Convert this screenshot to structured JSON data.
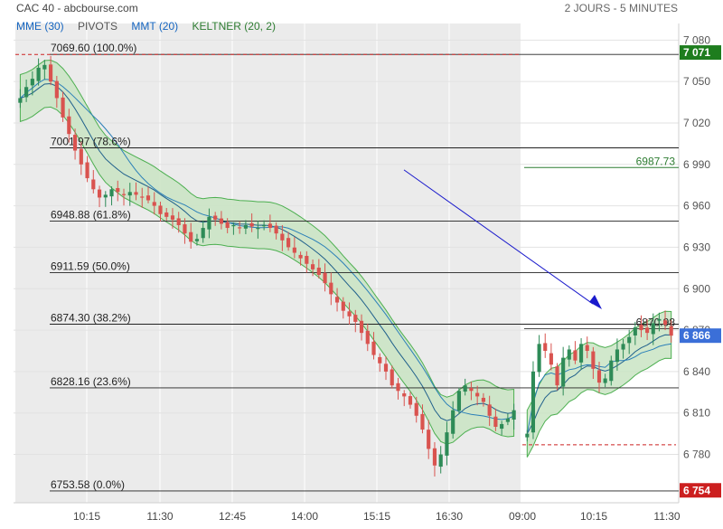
{
  "header": {
    "source": "CAC 40 - abcbourse.com",
    "timeframe": "2 JOURS - 5 MINUTES"
  },
  "legend": [
    {
      "label": "MME (30)",
      "color": "#1565c0"
    },
    {
      "label": "PIVOTS",
      "color": "#555555"
    },
    {
      "label": "MMT (20)",
      "color": "#1565c0"
    },
    {
      "label": "KELTNER (20, 2)",
      "color": "#2e7d32"
    }
  ],
  "colors": {
    "up_candle": "#2e8b57",
    "down_candle": "#d9534f",
    "keltner_fill": "#c9e4c3",
    "keltner_line": "#4caf50",
    "ma_line": "#1f5f8b",
    "session_bg": "#ebebeb",
    "trend_arrow": "#1a1acc",
    "last_price_bg": "#3b6fd8",
    "high_badge_bg": "#1e7d1e",
    "low_badge_bg": "#cc1f1f"
  },
  "chart_data": {
    "type": "candlestick",
    "ylim": [
      6745,
      7092
    ],
    "y_ticks": [
      7080,
      7050,
      7020,
      6990,
      6960,
      6930,
      6900,
      6870,
      6840,
      6810,
      6780
    ],
    "y_tick_labels": [
      "7 080",
      "7 050",
      "7 020",
      "6 990",
      "6 960",
      "6 930",
      "6 900",
      "6 870",
      "6 840",
      "6 810",
      "6 780"
    ],
    "x_ticks": [
      "10:15",
      "11:30",
      "12:45",
      "14:00",
      "15:15",
      "16:30",
      "09:00",
      "10:15",
      "11:30"
    ],
    "fibonacci": [
      {
        "value": 7069.6,
        "label": "7069.60  (100.0%)"
      },
      {
        "value": 7001.97,
        "label": "7001.97  (78.6%)"
      },
      {
        "value": 6948.88,
        "label": "6948.88  (61.8%)"
      },
      {
        "value": 6911.59,
        "label": "6911.59  (50.0%)"
      },
      {
        "value": 6874.3,
        "label": "6874.30  (38.2%)"
      },
      {
        "value": 6828.16,
        "label": "6828.16  (23.6%)"
      },
      {
        "value": 6753.58,
        "label": "6753.58  (0.0%)"
      }
    ],
    "pivot_lines": [
      {
        "value": 6987.73,
        "label": "6987.73"
      },
      {
        "value": 6870.98,
        "label": "6870.98"
      }
    ],
    "dashed_levels": [
      {
        "value": 7069.6,
        "session": "day1"
      },
      {
        "value": 6787,
        "session": "day2"
      }
    ],
    "badges": [
      {
        "value": 7071,
        "label": "7 071",
        "kind": "high"
      },
      {
        "value": 6866,
        "label": "6 866",
        "kind": "last"
      },
      {
        "value": 6754,
        "label": "6 754",
        "kind": "low"
      }
    ],
    "trend_arrow": {
      "from": [
        34,
        6986
      ],
      "to": [
        85,
        6889
      ]
    },
    "day1_close_series": [
      7038,
      7046,
      7052,
      7060,
      7062,
      7050,
      7038,
      7024,
      7012,
      7000,
      6990,
      6980,
      6972,
      6966,
      6968,
      6972,
      6970,
      6968,
      6970,
      6968,
      6966,
      6964,
      6960,
      6954,
      6952,
      6950,
      6946,
      6940,
      6934,
      6936,
      6944,
      6952,
      6950,
      6947,
      6944,
      6946,
      6944,
      6946,
      6945,
      6944,
      6946,
      6944,
      6940,
      6935,
      6930,
      6926,
      6922,
      6918,
      6914,
      6910,
      6904,
      6896,
      6890,
      6884,
      6880,
      6876,
      6868,
      6860,
      6852,
      6846,
      6840,
      6830,
      6826,
      6822,
      6816,
      6808,
      6798,
      6784,
      6772,
      6780,
      6796,
      6812,
      6826,
      6830,
      6826,
      6822,
      6818,
      6808,
      6800,
      6802,
      6806,
      6812
    ],
    "day2_close_series": [
      6795,
      6840,
      6860,
      6855,
      6845,
      6830,
      6850,
      6856,
      6848,
      6860,
      6855,
      6842,
      6832,
      6835,
      6848,
      6856,
      6860,
      6865,
      6872,
      6870,
      6868,
      6875,
      6878,
      6874,
      6866
    ]
  }
}
